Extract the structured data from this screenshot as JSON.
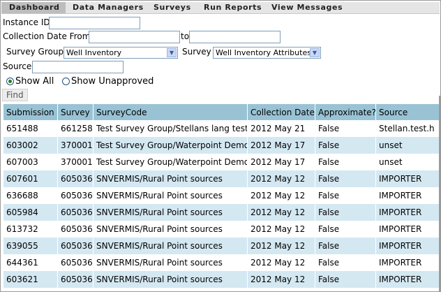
{
  "menu": [
    "Dashboard",
    "Data Managers",
    "Surveys",
    "Run Reports",
    "View Messages"
  ],
  "filters": {
    "instance_id_label": "Instance ID",
    "collection_date_from_label": "Collection Date From",
    "to_label": "to",
    "survey_group_label": "Survey Group",
    "survey_group_value": "Well Inventory",
    "survey_label": "Survey",
    "survey_value": "Well Inventory Attributes",
    "source_label": "Source",
    "show_all_label": "Show All",
    "show_unapproved_label": "Show Unapproved",
    "show_all_selected": true,
    "find_label": "Find"
  },
  "table": {
    "headers": [
      "Submission",
      "Survey",
      "SurveyCode",
      "Collection Date",
      "Approximate?",
      "Source"
    ],
    "rows": [
      [
        "651488",
        "661258",
        "Test Survey Group/Stellans lang test",
        "2012 May 21",
        "False",
        "Stellan.test.h"
      ],
      [
        "603002",
        "370001",
        "Test Survey Group/Waterpoint Demo",
        "2012 May 17",
        "False",
        "unset"
      ],
      [
        "607003",
        "370001",
        "Test Survey Group/Waterpoint Demo",
        "2012 May 17",
        "False",
        "unset"
      ],
      [
        "607601",
        "605036",
        "SNVERMIS/Rural Point sources",
        "2012 May 12",
        "False",
        "IMPORTER"
      ],
      [
        "636688",
        "605036",
        "SNVERMIS/Rural Point sources",
        "2012 May 12",
        "False",
        "IMPORTER"
      ],
      [
        "605984",
        "605036",
        "SNVERMIS/Rural Point sources",
        "2012 May 12",
        "False",
        "IMPORTER"
      ],
      [
        "613732",
        "605036",
        "SNVERMIS/Rural Point sources",
        "2012 May 12",
        "False",
        "IMPORTER"
      ],
      [
        "639055",
        "605036",
        "SNVERMIS/Rural Point sources",
        "2012 May 12",
        "False",
        "IMPORTER"
      ],
      [
        "644361",
        "605036",
        "SNVERMIS/Rural Point sources",
        "2012 May 12",
        "False",
        "IMPORTER"
      ],
      [
        "603621",
        "605036",
        "SNVERMIS/Rural Point sources",
        "2012 May 12",
        "False",
        "IMPORTER"
      ]
    ]
  }
}
